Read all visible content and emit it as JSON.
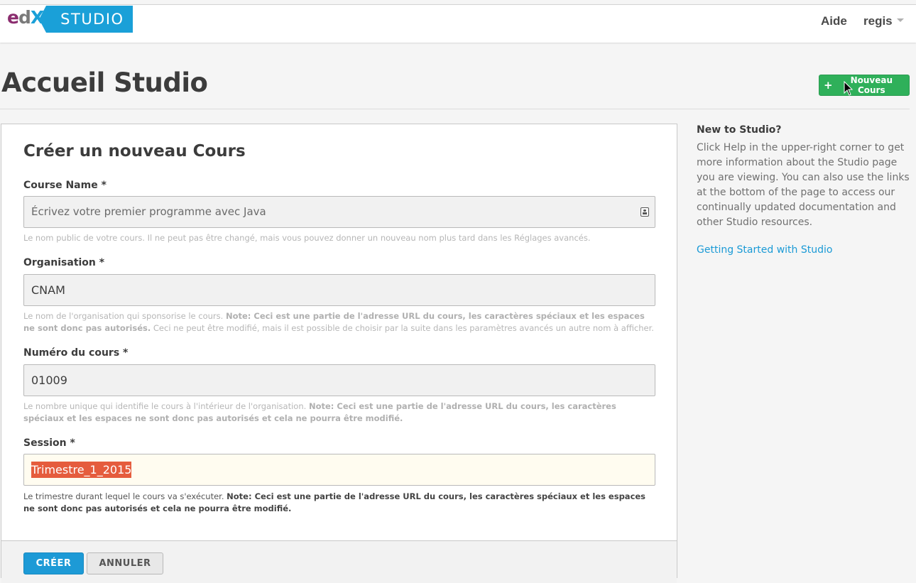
{
  "header": {
    "logo_e": "e",
    "logo_d": "d",
    "logo_x": "X",
    "logo_studio": "STUDIO",
    "help_label": "Aide",
    "user_label": "regis"
  },
  "page": {
    "title": "Accueil Studio",
    "new_course_label": "Nouveau Cours"
  },
  "form": {
    "title": "Créer un nouveau Cours",
    "fields": {
      "course_name": {
        "label": "Course Name *",
        "value": "Écrivez votre premier programme avec Java",
        "help": "Le nom public de votre cours. Il ne peut pas être changé, mais vous pouvez donner un nouveau nom plus tard dans les Réglages avancés."
      },
      "organisation": {
        "label": "Organisation *",
        "value": "CNAM",
        "help_a": "Le nom de l'organisation qui sponsorise le cours. ",
        "help_note": "Note: Ceci est une partie de l'adresse URL du cours, les caractères spéciaux et les espaces ne sont donc pas autorisés.",
        "help_b": " Ceci ne peut être modifié, mais il est possible de choisir par la suite dans les paramètres avancés un autre nom à afficher."
      },
      "course_number": {
        "label": "Numéro du cours *",
        "value": "01009",
        "help_a": "Le nombre unique qui identifie le cours à l'intérieur de l'organisation. ",
        "help_note": "Note: Ceci est une partie de l'adresse URL du cours, les caractères spéciaux et les espaces ne sont donc pas autorisés et cela ne pourra être modifié."
      },
      "session": {
        "label": "Session *",
        "value": "Trimestre_1_2015",
        "help_a": "Le trimestre durant lequel le cours va s'exécuter. ",
        "help_note": "Note: Ceci est une partie de l'adresse URL du cours, les caractères spéciaux et les espaces ne sont donc pas autorisés et cela ne pourra être modifié."
      }
    },
    "create_label": "CRÉER",
    "cancel_label": "ANNULER"
  },
  "sidebar": {
    "title": "New to Studio?",
    "text": "Click Help in the upper-right corner to get more information about the Studio page you are viewing. You can also use the links at the bottom of the page to access our continually updated documentation and other Studio resources.",
    "link_label": "Getting Started with Studio"
  }
}
